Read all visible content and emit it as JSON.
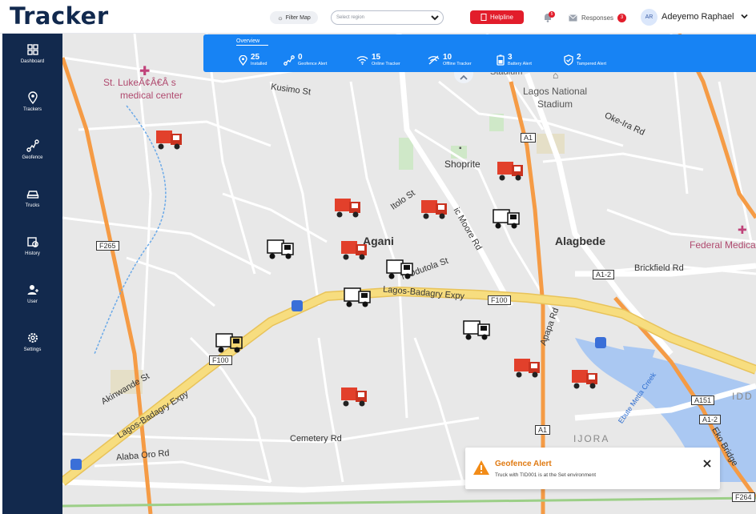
{
  "header": {
    "logo": "Tracker",
    "filter_label": "Filter Map",
    "region_placeholder": "Select region",
    "helpline_label": "Helpline",
    "notifications_count": "5",
    "responses_label": "Responses",
    "responses_count": "3",
    "user_initials": "AR",
    "user_name": "Adeyemo Raphael"
  },
  "sidebar": {
    "items": [
      {
        "label": "Dashboard",
        "icon": "grid-icon"
      },
      {
        "label": "Trackers",
        "icon": "location-pin-icon"
      },
      {
        "label": "Geofence",
        "icon": "route-icon"
      },
      {
        "label": "Trucks",
        "icon": "car-icon"
      },
      {
        "label": "History",
        "icon": "calendar-clock-icon"
      },
      {
        "label": "User",
        "icon": "user-icon"
      },
      {
        "label": "Settings",
        "icon": "gear-icon"
      }
    ]
  },
  "overview": {
    "title": "Overview",
    "stats": [
      {
        "value": "25",
        "label": "Installed",
        "icon": "location-pin-icon"
      },
      {
        "value": "0",
        "label": "Geofence Alert",
        "icon": "route-icon"
      },
      {
        "value": "15",
        "label": "Online Tracker",
        "icon": "wifi-icon"
      },
      {
        "value": "10",
        "label": "Offline Tracker",
        "icon": "wifi-off-icon"
      },
      {
        "value": "3",
        "label": "Battery Alert",
        "icon": "battery-icon"
      },
      {
        "value": "2",
        "label": "Tampered Alert",
        "icon": "shield-icon"
      }
    ]
  },
  "map": {
    "labels": {
      "st_luke_1": "St. LukeÃ¢Â€Â s",
      "st_luke_2": "medical center",
      "kusimo": "Kusimo St",
      "stadium_top": "Stadium",
      "lagos_stadium_1": "Lagos National",
      "lagos_stadium_2": "Stadium",
      "oke_ira": "Oke-Ira Rd",
      "a1_top": "A1",
      "shoprite": "Shoprite",
      "itolo": "Itolo St",
      "moore": "ic Moore Rd",
      "agani": "Agani",
      "alagbede": "Alagbede",
      "federal": "Federal Medica",
      "f265": "F265",
      "odutola": "h Odutola St",
      "a1_2_right": "A1-2",
      "brickfield": "Brickfield Rd",
      "lagos_badagry_1": "Lagos-Badagry Expy",
      "f100_mid": "F100",
      "apapa": "Apapa Rd",
      "f100_left": "F100",
      "akinwande": "Akinwande St",
      "lagos_badagry_2": "Lagos-Badagry Expy",
      "ebute": "Ebute Metta Creek",
      "a151": "A151",
      "idd": "IDD",
      "a1_2_bottom": "A1-2",
      "cemetery": "Cemetery Rd",
      "a1_bottom": "A1",
      "ijora": "IJORA",
      "eko": "Eko Bridge",
      "alaba": "Alaba Oro Rd",
      "f264": "F264"
    }
  },
  "alert": {
    "title": "Geofence Alert",
    "message": "Truck with TID001 is at the Set environment"
  },
  "colors": {
    "sidebar": "#12294d",
    "overview": "#1783f4",
    "helpline": "#e21d2b",
    "alert": "#e07a12",
    "truck_red": "#e2402b",
    "highway": "#f5d771",
    "arterial": "#f59b45"
  }
}
